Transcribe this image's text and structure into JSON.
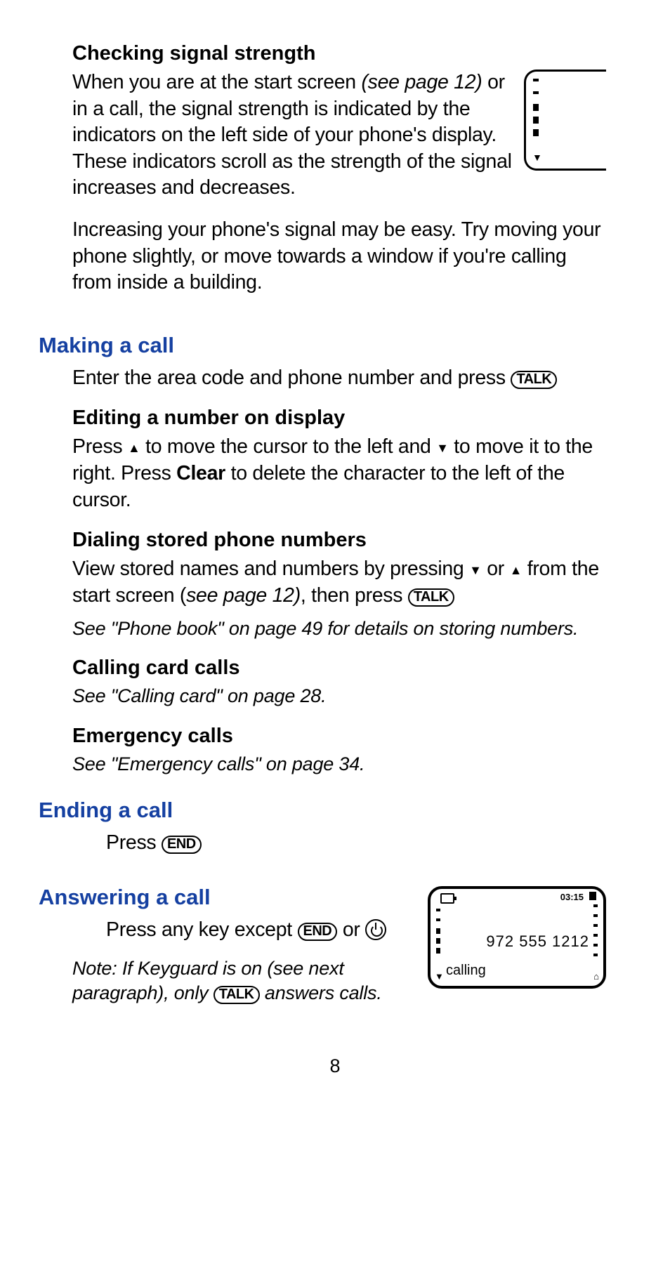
{
  "s1": {
    "heading": "Checking signal strength",
    "p1_a": "When you are at the start screen ",
    "p1_ref": "(see page 12)",
    "p1_b": " or in a call, the signal strength is indicated by the indicators on the left side of your phone's display. These indicators scroll as the strength of the signal increases and decreases.",
    "p2": "Increasing your phone's signal may be easy. Try moving your phone slightly, or move towards a window if you're calling from inside a building."
  },
  "s2": {
    "heading": "Making a call",
    "p1": "Enter the area code and phone number and press ",
    "key": "TALK"
  },
  "s3": {
    "heading": "Editing a number on display",
    "p1_a": "Press ",
    "p1_b": " to move the cursor to the left and ",
    "p1_c": " to move it to the right. Press ",
    "clear": "Clear",
    "p1_d": " to delete the character to the left of the cursor."
  },
  "s4": {
    "heading": "Dialing stored phone numbers",
    "p1_a": "View stored names and numbers by pressing ",
    "p1_b": " or ",
    "p1_c": " from the start screen (",
    "ref": "see page 12)",
    "p1_d": ", then press ",
    "key": "TALK",
    "p2": "See \"Phone book\" on page 49 for details on storing numbers."
  },
  "s5": {
    "heading": "Calling card calls",
    "p1": "See \"Calling card\" on page 28."
  },
  "s6": {
    "heading": "Emergency calls",
    "p1": "See \"Emergency calls\" on page 34."
  },
  "s7": {
    "heading": "Ending a call",
    "p1": "Press ",
    "key": "END"
  },
  "s8": {
    "heading": "Answering a call",
    "p1_a": "Press any key except ",
    "key": "END",
    "p1_b": " or ",
    "note_a": "Note: If Keyguard is on (see next paragraph), only ",
    "note_key": "TALK",
    "note_b": " answers calls."
  },
  "screen": {
    "time": "03:15",
    "number": "972 555 1212",
    "status": "calling"
  },
  "page_number": "8"
}
